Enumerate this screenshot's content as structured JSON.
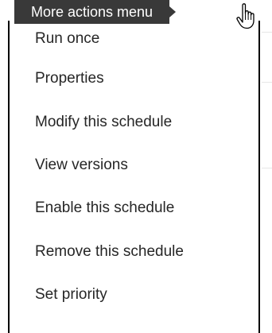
{
  "tooltip": {
    "text": "More actions menu"
  },
  "menu": {
    "items": [
      {
        "label": "Run once"
      },
      {
        "label": "Properties"
      },
      {
        "label": "Modify this schedule"
      },
      {
        "label": "View versions"
      },
      {
        "label": "Enable this schedule"
      },
      {
        "label": "Remove this schedule"
      },
      {
        "label": "Set priority"
      }
    ]
  },
  "colors": {
    "tooltip_bg": "#393939",
    "menu_text": "#262626",
    "menu_border": "#000000"
  },
  "icons": {
    "cursor": "hand-pointer-icon"
  }
}
